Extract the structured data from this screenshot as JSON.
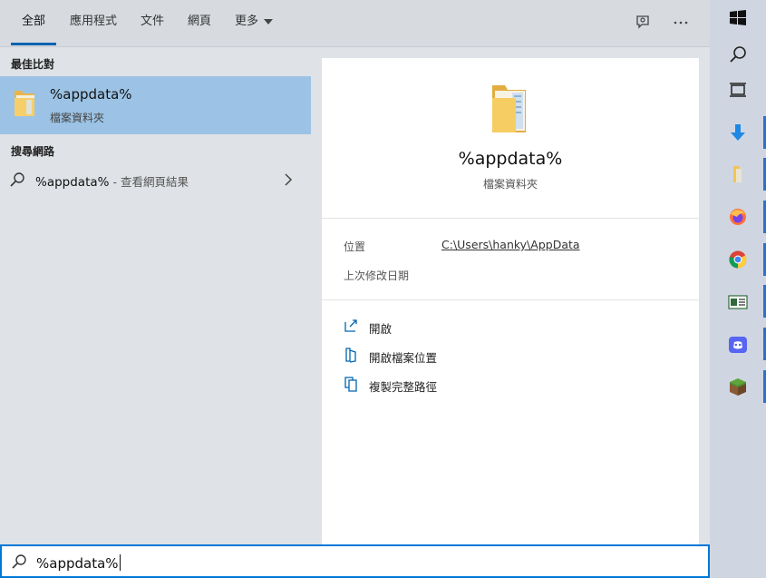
{
  "tabs": [
    {
      "label": "全部",
      "active": true
    },
    {
      "label": "應用程式"
    },
    {
      "label": "文件"
    },
    {
      "label": "網頁"
    },
    {
      "label": "更多"
    }
  ],
  "left": {
    "best_match_heading": "最佳比對",
    "best_match": {
      "title": "%appdata%",
      "subtitle": "檔案資料夾",
      "icon": "folder-icon"
    },
    "web_heading": "搜尋網路",
    "web_result": {
      "query": "%appdata%",
      "suffix": " - 查看網頁結果"
    }
  },
  "preview": {
    "title": "%appdata%",
    "subtitle": "檔案資料夾",
    "location_label": "位置",
    "location_value": "C:\\Users\\hanky\\AppData",
    "modified_label": "上次修改日期",
    "actions": [
      {
        "label": "開啟",
        "icon": "open-icon"
      },
      {
        "label": "開啟檔案位置",
        "icon": "open-location-icon"
      },
      {
        "label": "複製完整路徑",
        "icon": "copy-path-icon"
      }
    ]
  },
  "search": {
    "value": "%appdata%"
  },
  "taskbar": [
    "windows-start-icon",
    "search-icon",
    "task-view-icon",
    "download-icon",
    "file-explorer-icon",
    "firefox-icon",
    "chrome-icon",
    "news-app-icon",
    "discord-icon",
    "minecraft-icon"
  ],
  "colors": {
    "accent": "#0063b1",
    "selection": "#9cc3e5",
    "search_border": "#0078d7"
  }
}
